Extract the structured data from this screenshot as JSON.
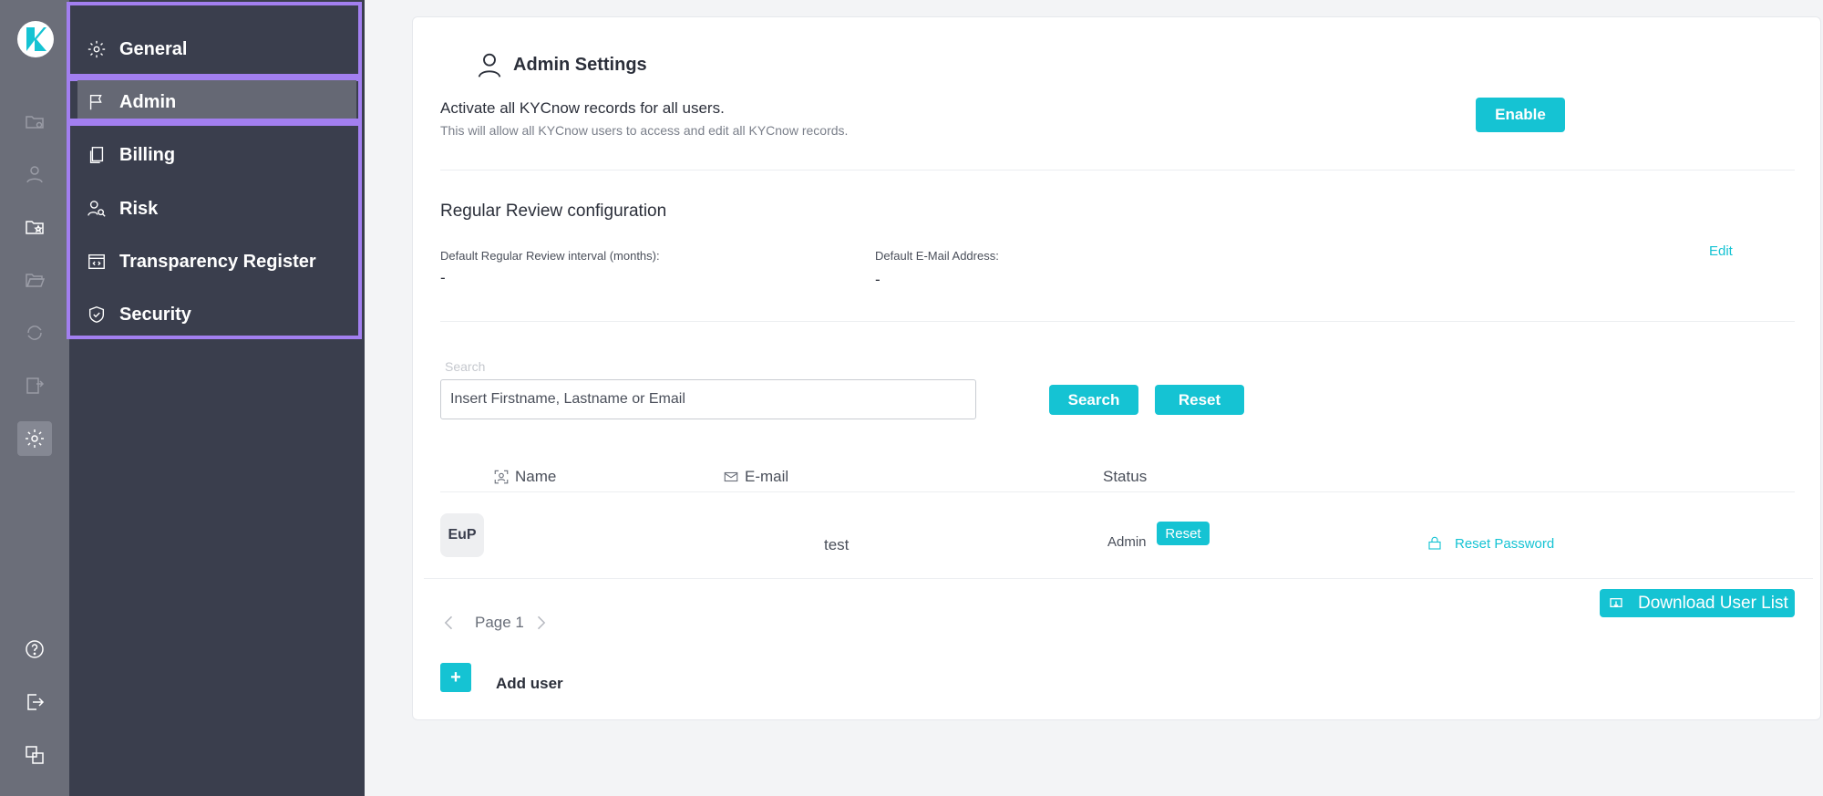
{
  "colors": {
    "accent": "#15c3d3",
    "rail": "#6b6e79",
    "subnav": "#3a3e4d",
    "highlight": "#a27ff0"
  },
  "rail": {
    "icons": [
      "logo-k",
      "folder-settings-icon",
      "user-search-icon",
      "folder-star-icon",
      "folder-open-icon",
      "sync-icon",
      "document-transfer-icon",
      "gear-icon",
      "help-icon",
      "logout-icon",
      "translate-icon"
    ]
  },
  "subnav": {
    "items": [
      {
        "label": "General",
        "icon": "gear-icon"
      },
      {
        "label": "Admin",
        "icon": "flag-icon"
      },
      {
        "label": "Billing",
        "icon": "document-copy-icon"
      },
      {
        "label": "Risk",
        "icon": "user-search-icon"
      },
      {
        "label": "Transparency Register",
        "icon": "code-window-icon"
      },
      {
        "label": "Security",
        "icon": "shield-check-icon"
      }
    ],
    "active": "Admin"
  },
  "admin": {
    "title": "Admin Settings",
    "activate_text": "Activate all KYCnow records for all users.",
    "activate_sub": "This will allow all KYCnow users to access and edit all KYCnow records.",
    "enable_label": "Enable"
  },
  "review": {
    "title": "Regular Review configuration",
    "interval_label": "Default Regular Review interval (months):",
    "interval_value": "-",
    "email_label": "Default E-Mail Address:",
    "email_value": "-",
    "edit_label": "Edit"
  },
  "search": {
    "label": "Search",
    "placeholder": "Insert Firstname, Lastname or Email",
    "search_label": "Search",
    "reset_label": "Reset"
  },
  "table": {
    "headers": {
      "name": "Name",
      "email": "E-mail",
      "status": "Status"
    },
    "rows": [
      {
        "initials": "EuP",
        "email": "test",
        "role": "Admin",
        "reset_label": "Reset",
        "reset_password": "Reset Password"
      }
    ]
  },
  "pagination": {
    "label": "Page 1"
  },
  "download_label": "Download User List",
  "add_user": {
    "plus": "+",
    "label": "Add user"
  }
}
